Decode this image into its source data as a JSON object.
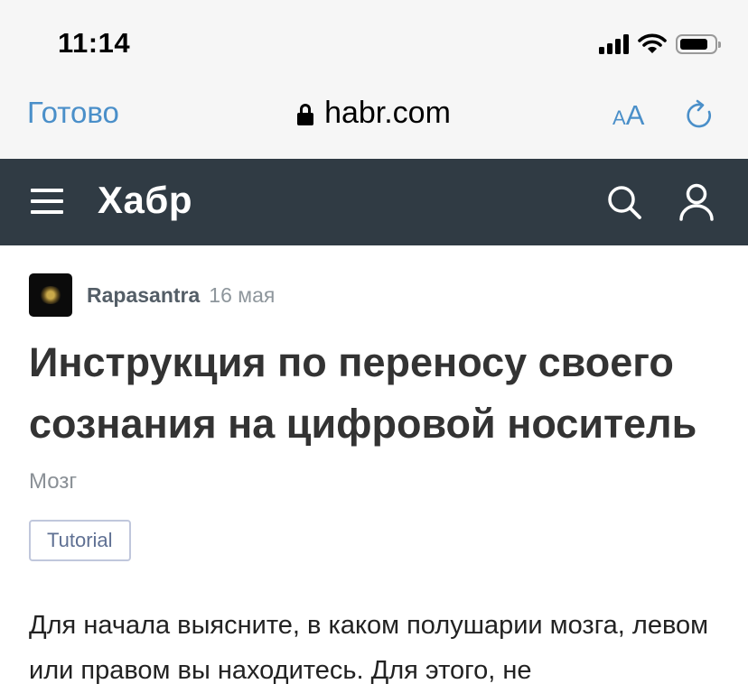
{
  "status_bar": {
    "time": "11:14"
  },
  "browser": {
    "done_label": "Готово",
    "domain": "habr.com",
    "text_size_small": "A",
    "text_size_big": "A"
  },
  "site_header": {
    "logo": "Хабр"
  },
  "article": {
    "author": "Rapasantra",
    "date": "16 мая",
    "title": "Инструкция по переносу своего сознания на цифровой носитель",
    "hub": "Мозг",
    "tag": "Tutorial",
    "body": "Для начала выясните, в каком полушарии мозга, левом или правом вы находитесь. Для этого, не"
  },
  "colors": {
    "ios_blue": "#4a8fc9",
    "habr_header": "#303b44",
    "tag_border": "#c0c7dc"
  },
  "icons": [
    "lock-icon",
    "reload-icon",
    "menu-icon",
    "search-icon",
    "user-icon",
    "signal-icon",
    "wifi-icon",
    "battery-icon"
  ]
}
